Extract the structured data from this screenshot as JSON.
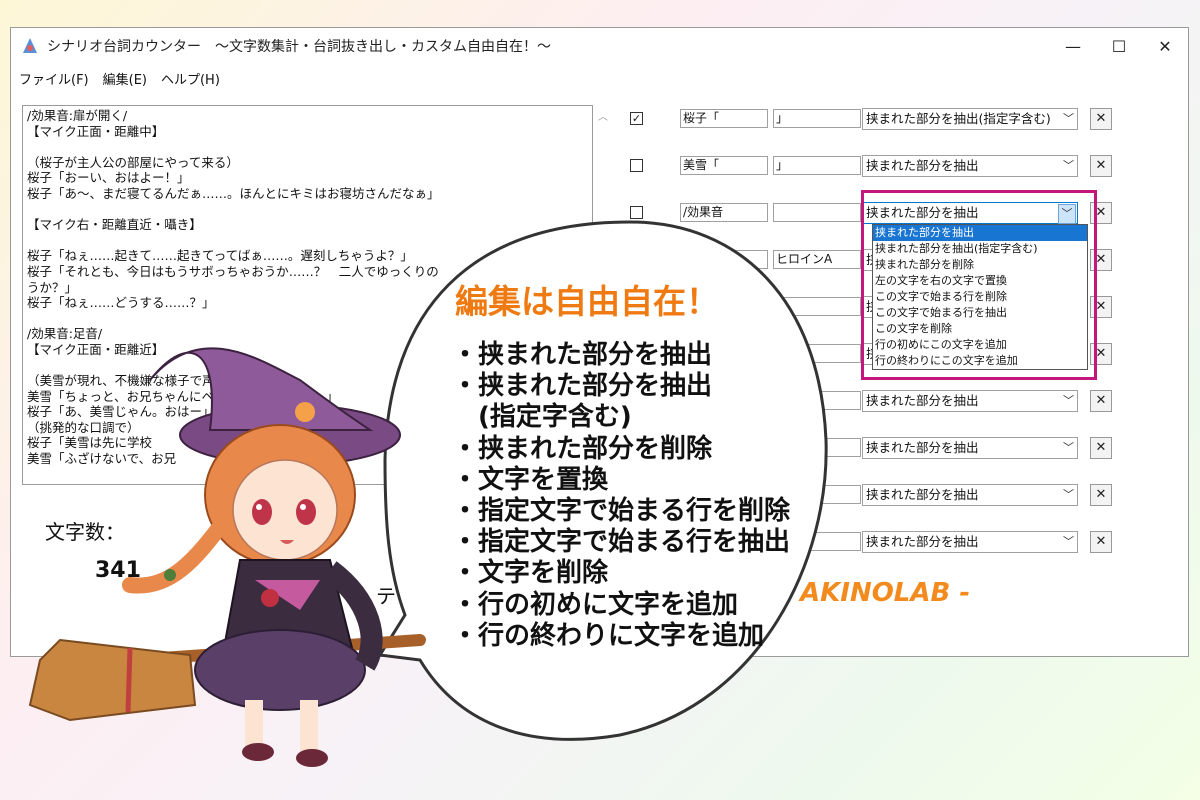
{
  "window": {
    "title": "シナリオ台詞カウンター　～文字数集計・台詞抜き出し・カスタム自由自在！～",
    "controls": {
      "minimize": "—",
      "maximize": "☐",
      "close": "✕"
    }
  },
  "menu": [
    "ファイル(F)",
    "編集(E)",
    "ヘルプ(H)"
  ],
  "editor": {
    "lines": [
      "/効果音:扉が開く/",
      "【マイク正面・距離中】",
      "",
      "（桜子が主人公の部屋にやって来る）",
      "桜子「おーい、おはよー！」",
      "桜子「あ～、まだ寝てるんだぁ……。ほんとにキミはお寝坊さんだなぁ」",
      "",
      "【マイク右・距離直近・囁き】",
      "",
      "桜子「ねぇ……起きて……起きてってばぁ……。遅刻しちゃうよ？」",
      "桜子「それとも、今日はもうサボっちゃおうか……？　二人でゆっくりの",
      "うか？」",
      "桜子「ねぇ……どうする……？」",
      "",
      "/効果音:足音/",
      "【マイク正面・距離近】",
      "",
      "（美雪が現れ、不機嫌な様子で声をかける）",
      "美雪「ちょっと、お兄ちゃんにベタベタしないでよ！」",
      "桜子「あ、美雪じゃん。おはー」",
      "（挑発的な口調で）",
      "桜子「美雪は先に学校　　　　　いよ。こいつは私が面倒",
      "美雪「ふざけないで、お兄　　　　　　は私の役目なん"
    ]
  },
  "stats": {
    "count_label": "文字数：",
    "count_value": "341",
    "te_label": "テ"
  },
  "rules": [
    {
      "checked": true,
      "check_glyph": "✓",
      "start": "桜子「",
      "end": "」",
      "action": "挟まれた部分を抽出(指定字含む)"
    },
    {
      "checked": false,
      "check_glyph": "",
      "start": "美雪「",
      "end": "」",
      "action": "挟まれた部分を抽出"
    },
    {
      "checked": false,
      "check_glyph": "",
      "start": "/効果音",
      "end": "",
      "action": "挟まれた部分を抽出"
    },
    {
      "checked": false,
      "check_glyph": "",
      "start": "",
      "end": "ヒロインA",
      "action": "挟まれた部分を抽出"
    },
    {
      "checked": false,
      "check_glyph": "",
      "start": "",
      "end": "",
      "action": "挟まれた部分を抽出"
    },
    {
      "checked": false,
      "check_glyph": "",
      "start": "",
      "end": "",
      "action": "挟まれた部分を抽出"
    },
    {
      "checked": false,
      "check_glyph": "",
      "start": "",
      "end": "",
      "action": "挟まれた部分を抽出"
    },
    {
      "checked": false,
      "check_glyph": "",
      "start": "",
      "end": "",
      "action": "挟まれた部分を抽出"
    },
    {
      "checked": false,
      "check_glyph": "",
      "start": "",
      "end": "",
      "action": "挟まれた部分を抽出"
    },
    {
      "checked": false,
      "check_glyph": "",
      "start": "",
      "end": "",
      "action": "挟まれた部分を抽出"
    }
  ],
  "delete_glyph": "✕",
  "dropdown_options": [
    "挟まれた部分を抽出",
    "挟まれた部分を抽出(指定字含む)",
    "挟まれた部分を削除",
    "左の文字を右の文字で置換",
    "この文字で始まる行を削除",
    "この文字で始まる行を抽出",
    "この文字を削除",
    "行の初めにこの文字を追加",
    "行の終わりにこの文字を追加"
  ],
  "brand": "AKINOLAB -",
  "bubble": {
    "title": "編集は自由自在！",
    "items": [
      "・挟まれた部分を抽出",
      "・挟まれた部分を抽出",
      "　(指定字含む)",
      "・挟まれた部分を削除",
      "・文字を置換",
      "・指定文字で始まる行を削除",
      "・指定文字で始まる行を抽出",
      "・文字を削除",
      "・行の初めに文字を追加",
      "・行の終わりに文字を追加"
    ]
  },
  "colors": {
    "accent_orange": "#f07a12",
    "highlight_magenta": "#c4177c",
    "selected_option": "#1975d2"
  }
}
